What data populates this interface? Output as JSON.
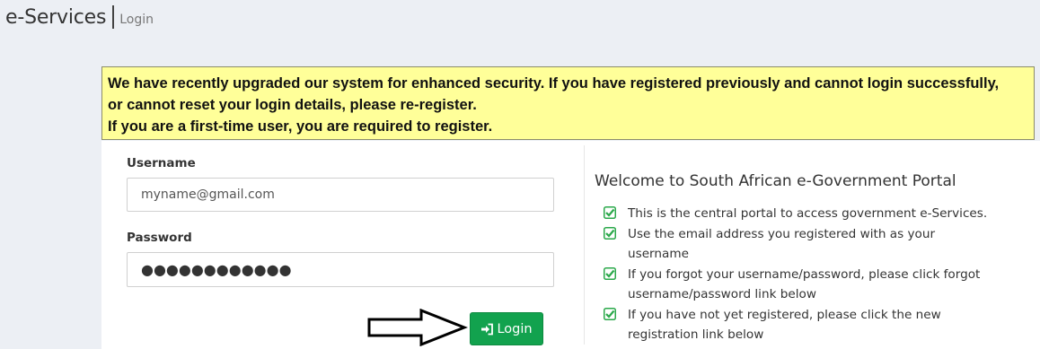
{
  "header": {
    "title": "e-Services",
    "subtitle": "Login"
  },
  "banner": {
    "line1": "We have recently upgraded our system for enhanced security. If you have registered previously and cannot login successfully,",
    "line2": "or cannot reset your login details, please re-register.",
    "line3": "If you are a first-time user, you are required to register."
  },
  "form": {
    "username_label": "Username",
    "username_value": "myname@gmail.com",
    "password_label": "Password",
    "password_value": "●●●●●●●●●●●●",
    "login_label": "Login",
    "login_icon": "sign-in-icon",
    "pointer_icon": "arrow-right-outline-icon"
  },
  "welcome": {
    "title": "Welcome to South African e-Government Portal",
    "check_icon": "check-square-icon",
    "check_color": "#2aa84a",
    "items": [
      "This is the central portal to access government e-Services.",
      "Use the email address you registered with as your username",
      "If you forgot your username/password, please click forgot username/password link below",
      "If you have not yet registered, please click the new registration link below"
    ]
  },
  "colors": {
    "banner_bg": "#ffff99",
    "button_green": "#12a24e",
    "page_bg": "#eceff4"
  }
}
